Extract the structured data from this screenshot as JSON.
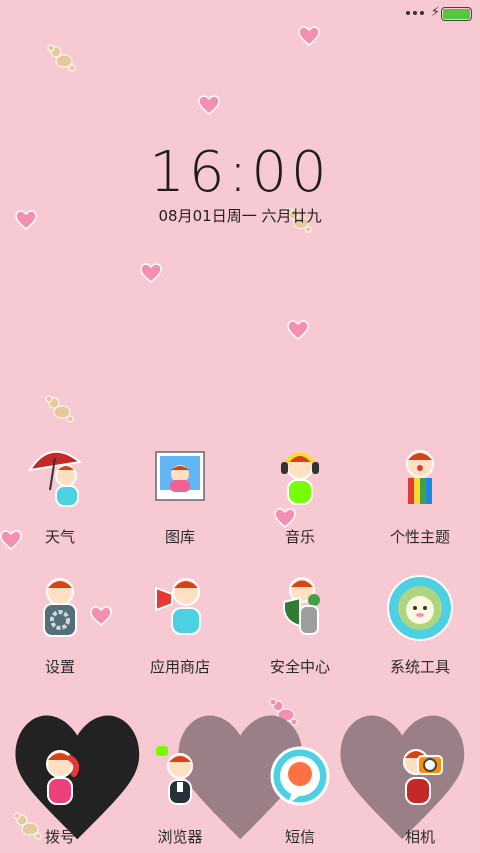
{
  "status_bar": {
    "battery_level": 1.0,
    "battery_color": "#53c93a"
  },
  "lockscreen": {
    "time": "16:00",
    "date": "08月01日周一 六月廿九"
  },
  "apps_row1": [
    {
      "label": "天气",
      "icon": "weather-umbrella-icon"
    },
    {
      "label": "图库",
      "icon": "gallery-photo-icon"
    },
    {
      "label": "音乐",
      "icon": "music-headphones-icon"
    },
    {
      "label": "个性主题",
      "icon": "theme-rainbow-icon"
    }
  ],
  "apps_row2": [
    {
      "label": "设置",
      "icon": "settings-gear-icon"
    },
    {
      "label": "应用商店",
      "icon": "app-store-megaphone-icon"
    },
    {
      "label": "安全中心",
      "icon": "security-shield-icon"
    },
    {
      "label": "系统工具",
      "icon": "system-tools-sheep-icon"
    }
  ],
  "dock": [
    {
      "label": "拨号",
      "icon": "phone-dialer-icon"
    },
    {
      "label": "浏览器",
      "icon": "browser-icon"
    },
    {
      "label": "短信",
      "icon": "messages-bubble-icon"
    },
    {
      "label": "相机",
      "icon": "camera-icon"
    }
  ],
  "page_indicator": {
    "pages": 3,
    "current": 1
  },
  "colors": {
    "background": "#f7c9d2",
    "heart": "#f48fb1",
    "text": "#2a2a2a"
  }
}
